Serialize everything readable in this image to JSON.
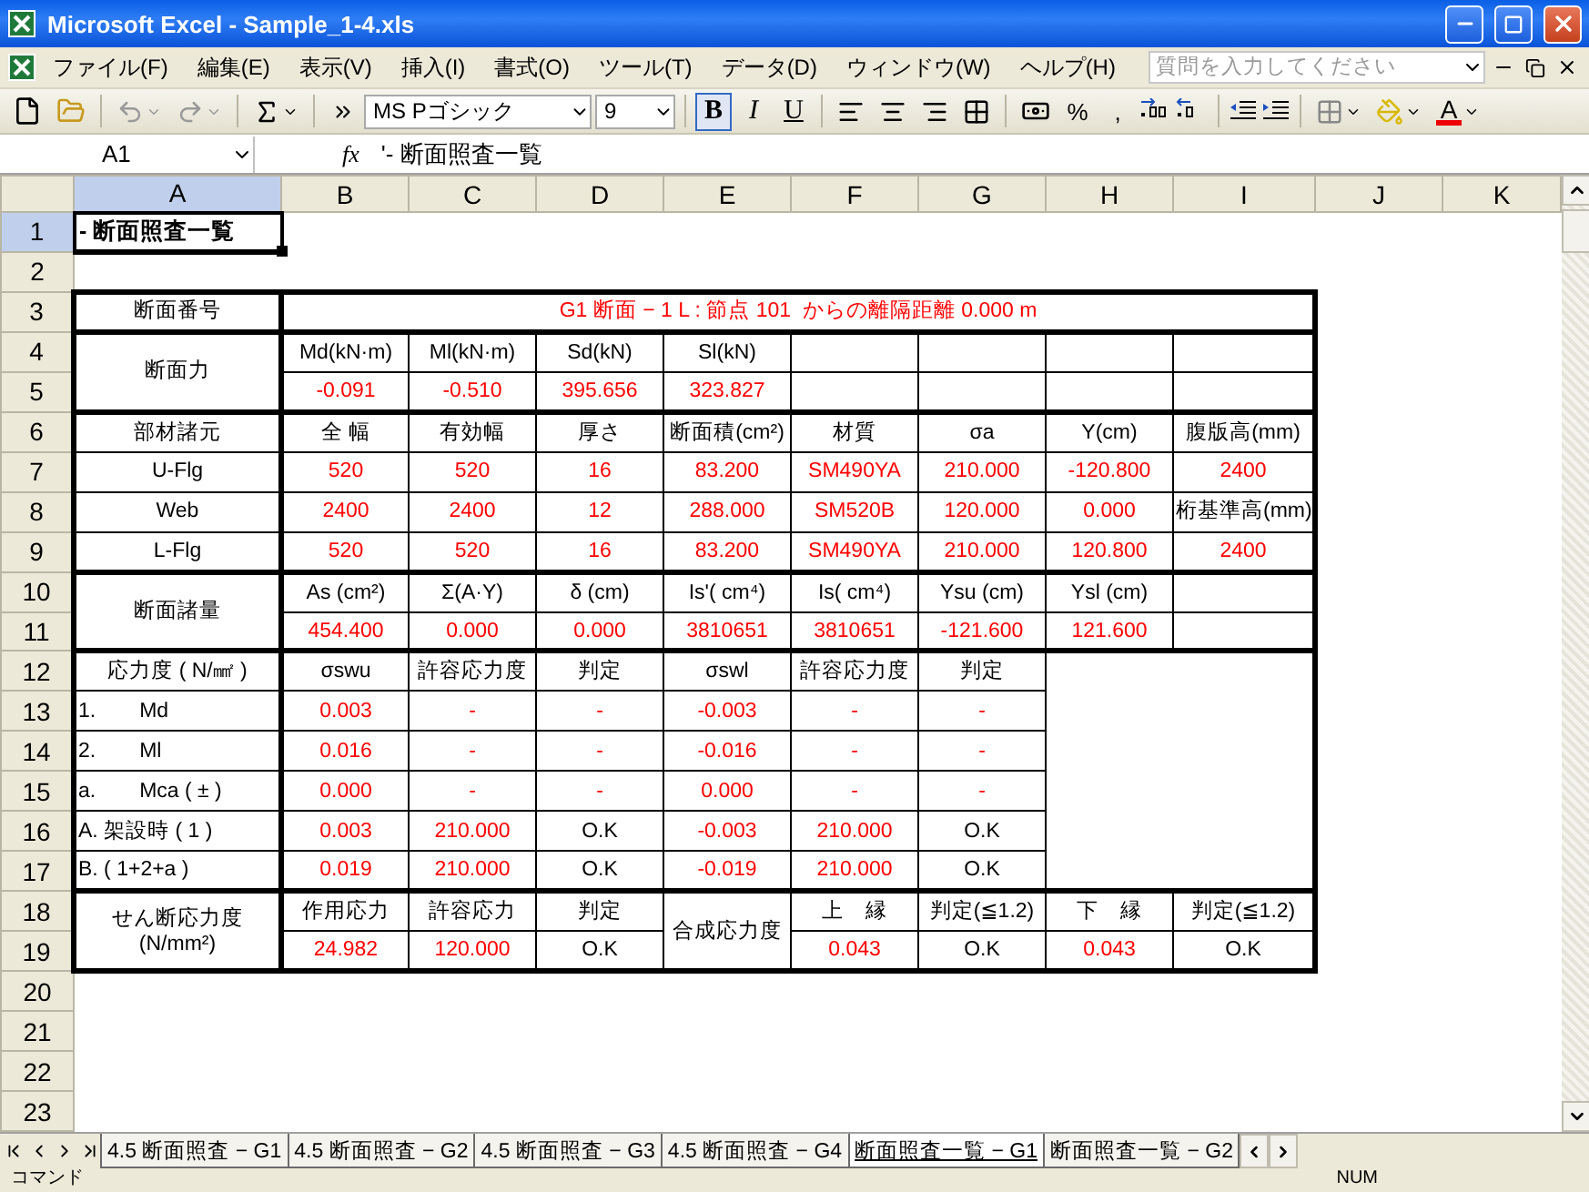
{
  "window": {
    "title": "Microsoft Excel - Sample_1-4.xls"
  },
  "menu": {
    "items": [
      "ファイル(F)",
      "編集(E)",
      "表示(V)",
      "挿入(I)",
      "書式(O)",
      "ツール(T)",
      "データ(D)",
      "ウィンドウ(W)",
      "ヘルプ(H)"
    ],
    "help_search": {
      "placeholder": "質問を入力してください"
    }
  },
  "toolbar": {
    "font": "MS Pゴシック",
    "size": "9",
    "styles": [
      {
        "label": "B",
        "selected": true
      },
      {
        "label": "I",
        "selected": false
      },
      {
        "label": "U",
        "selected": false
      }
    ],
    "number_formats": [
      "%",
      ","
    ],
    "font_color_label": "A"
  },
  "formula_bar": {
    "cell": "A1",
    "fx": "fx",
    "value": "'- 断面照査一覧"
  },
  "sheet": {
    "columns": [
      {
        "label": "A",
        "selected": true
      },
      {
        "label": "B",
        "selected": false
      },
      {
        "label": "C",
        "selected": false
      },
      {
        "label": "D",
        "selected": false
      },
      {
        "label": "E",
        "selected": false
      },
      {
        "label": "F",
        "selected": false
      },
      {
        "label": "G",
        "selected": false
      },
      {
        "label": "H",
        "selected": false
      },
      {
        "label": "I",
        "selected": false
      },
      {
        "label": "J",
        "selected": false
      },
      {
        "label": "K",
        "selected": false
      }
    ],
    "groups": [
      {
        "kind": "free",
        "rows": [
          {
            "number": "1",
            "selected": true,
            "cells": [
              {
                "kind": "title",
                "text": "- 断面照査一覧",
                "active": true
              }
            ]
          }
        ]
      },
      {
        "kind": "free",
        "rows": [
          {
            "number": "2",
            "selected": false
          }
        ]
      },
      {
        "kind": "table",
        "rows": [
          {
            "number": "3",
            "selected": false,
            "cells": [
              {
                "kind": "label",
                "text": "断面番号"
              },
              {
                "kind": "value",
                "text": "G1 断面 − 1 L : 節点 101  からの離隔距離 0.000 m",
                "colspan": 8
              }
            ]
          }
        ]
      },
      {
        "kind": "table",
        "rows": [
          {
            "number": "4",
            "selected": false,
            "cells": [
              {
                "kind": "label",
                "text": "断面力",
                "rowspan": 2
              },
              {
                "kind": "label",
                "text": "Md(kN·m)"
              },
              {
                "kind": "label",
                "text": "Ml(kN·m)"
              },
              {
                "kind": "label",
                "text": "Sd(kN)"
              },
              {
                "kind": "label",
                "text": "Sl(kN)"
              },
              {
                "kind": "blank"
              },
              {
                "kind": "blank"
              },
              {
                "kind": "blank"
              },
              {
                "kind": "blank"
              }
            ]
          },
          {
            "number": "5",
            "selected": false,
            "cells": [
              {
                "kind": "value",
                "text": "-0.091"
              },
              {
                "kind": "value",
                "text": "-0.510"
              },
              {
                "kind": "value",
                "text": "395.656"
              },
              {
                "kind": "value",
                "text": "323.827"
              },
              {
                "kind": "blank"
              },
              {
                "kind": "blank"
              },
              {
                "kind": "blank"
              },
              {
                "kind": "blank"
              }
            ]
          }
        ]
      },
      {
        "kind": "table",
        "rows": [
          {
            "number": "6",
            "selected": false,
            "cells": [
              {
                "kind": "label",
                "text": "部材諸元"
              },
              {
                "kind": "label",
                "text": "全 幅"
              },
              {
                "kind": "label",
                "text": "有効幅"
              },
              {
                "kind": "label",
                "text": "厚さ"
              },
              {
                "kind": "label",
                "text": "断面積(cm²)"
              },
              {
                "kind": "label",
                "text": "材質"
              },
              {
                "kind": "label",
                "text": "σa"
              },
              {
                "kind": "label",
                "text": "Y(cm)"
              },
              {
                "kind": "label",
                "text": "腹版高(mm)"
              }
            ]
          },
          {
            "number": "7",
            "selected": false,
            "cells": [
              {
                "kind": "label",
                "text": "U-Flg"
              },
              {
                "kind": "value",
                "text": "520"
              },
              {
                "kind": "value",
                "text": "520"
              },
              {
                "kind": "value",
                "text": "16"
              },
              {
                "kind": "value",
                "text": "83.200"
              },
              {
                "kind": "value",
                "text": "SM490YA"
              },
              {
                "kind": "value",
                "text": "210.000"
              },
              {
                "kind": "value",
                "text": "-120.800"
              },
              {
                "kind": "value",
                "text": "2400"
              }
            ]
          },
          {
            "number": "8",
            "selected": false,
            "cells": [
              {
                "kind": "label",
                "text": "Web"
              },
              {
                "kind": "value",
                "text": "2400"
              },
              {
                "kind": "value",
                "text": "2400"
              },
              {
                "kind": "value",
                "text": "12"
              },
              {
                "kind": "value",
                "text": "288.000"
              },
              {
                "kind": "value",
                "text": "SM520B"
              },
              {
                "kind": "value",
                "text": "120.000"
              },
              {
                "kind": "value",
                "text": "0.000"
              },
              {
                "kind": "label",
                "text": "桁基準高(mm)"
              }
            ]
          },
          {
            "number": "9",
            "selected": false,
            "cells": [
              {
                "kind": "label",
                "text": "L-Flg"
              },
              {
                "kind": "value",
                "text": "520"
              },
              {
                "kind": "value",
                "text": "520"
              },
              {
                "kind": "value",
                "text": "16"
              },
              {
                "kind": "value",
                "text": "83.200"
              },
              {
                "kind": "value",
                "text": "SM490YA"
              },
              {
                "kind": "value",
                "text": "210.000"
              },
              {
                "kind": "value",
                "text": "120.800"
              },
              {
                "kind": "value",
                "text": "2400"
              }
            ]
          }
        ]
      },
      {
        "kind": "table",
        "rows": [
          {
            "number": "10",
            "selected": false,
            "cells": [
              {
                "kind": "label",
                "text": "断面諸量",
                "rowspan": 2
              },
              {
                "kind": "label",
                "text": "As (cm²)"
              },
              {
                "kind": "label",
                "text": "Σ(A·Y)"
              },
              {
                "kind": "label",
                "text": "δ (cm)"
              },
              {
                "kind": "label",
                "text": "Is'( cm⁴)"
              },
              {
                "kind": "label",
                "text": "Is( cm⁴)"
              },
              {
                "kind": "label",
                "text": "Ysu (cm)"
              },
              {
                "kind": "label",
                "text": "Ysl (cm)"
              },
              {
                "kind": "blank"
              }
            ]
          },
          {
            "number": "11",
            "selected": false,
            "cells": [
              {
                "kind": "value",
                "text": "454.400"
              },
              {
                "kind": "value",
                "text": "0.000"
              },
              {
                "kind": "value",
                "text": "0.000"
              },
              {
                "kind": "value",
                "text": "3810651"
              },
              {
                "kind": "value",
                "text": "3810651"
              },
              {
                "kind": "value",
                "text": "-121.600"
              },
              {
                "kind": "value",
                "text": "121.600"
              },
              {
                "kind": "blank"
              }
            ]
          }
        ]
      },
      {
        "kind": "table",
        "rows": [
          {
            "number": "12",
            "selected": false,
            "cells": [
              {
                "kind": "label",
                "text": "応力度 ( N/㎟ )"
              },
              {
                "kind": "label",
                "text": "σswu"
              },
              {
                "kind": "label",
                "text": "許容応力度"
              },
              {
                "kind": "label",
                "text": "判定"
              },
              {
                "kind": "label",
                "text": "σswl"
              },
              {
                "kind": "label",
                "text": "許容応力度"
              },
              {
                "kind": "label",
                "text": "判定"
              },
              {
                "kind": "block",
                "rowspan": 6,
                "colspan": 2
              }
            ]
          },
          {
            "number": "13",
            "selected": false,
            "cells": [
              {
                "kind": "item",
                "text": "1.　　Md"
              },
              {
                "kind": "value",
                "text": "0.003"
              },
              {
                "kind": "value",
                "text": "-"
              },
              {
                "kind": "value",
                "text": "-"
              },
              {
                "kind": "value",
                "text": "-0.003"
              },
              {
                "kind": "value",
                "text": "-"
              },
              {
                "kind": "value",
                "text": "-"
              }
            ]
          },
          {
            "number": "14",
            "selected": false,
            "cells": [
              {
                "kind": "item",
                "text": "2.　　Ml"
              },
              {
                "kind": "value",
                "text": "0.016"
              },
              {
                "kind": "value",
                "text": "-"
              },
              {
                "kind": "value",
                "text": "-"
              },
              {
                "kind": "value",
                "text": "-0.016"
              },
              {
                "kind": "value",
                "text": "-"
              },
              {
                "kind": "value",
                "text": "-"
              }
            ]
          },
          {
            "number": "15",
            "selected": false,
            "cells": [
              {
                "kind": "item",
                "text": "a.　　Mca ( ± )"
              },
              {
                "kind": "value",
                "text": "0.000"
              },
              {
                "kind": "value",
                "text": "-"
              },
              {
                "kind": "value",
                "text": "-"
              },
              {
                "kind": "value",
                "text": "0.000"
              },
              {
                "kind": "value",
                "text": "-"
              },
              {
                "kind": "value",
                "text": "-"
              }
            ]
          },
          {
            "number": "16",
            "selected": false,
            "cells": [
              {
                "kind": "item",
                "text": "A. 架設時 ( 1 )"
              },
              {
                "kind": "value",
                "text": "0.003"
              },
              {
                "kind": "value",
                "text": "210.000"
              },
              {
                "kind": "label",
                "text": "O.K"
              },
              {
                "kind": "value",
                "text": "-0.003"
              },
              {
                "kind": "value",
                "text": "210.000"
              },
              {
                "kind": "label",
                "text": "O.K"
              }
            ]
          },
          {
            "number": "17",
            "selected": false,
            "cells": [
              {
                "kind": "item",
                "text": "B. ( 1+2+a )"
              },
              {
                "kind": "value",
                "text": "0.019"
              },
              {
                "kind": "value",
                "text": "210.000"
              },
              {
                "kind": "label",
                "text": "O.K"
              },
              {
                "kind": "value",
                "text": "-0.019"
              },
              {
                "kind": "value",
                "text": "210.000"
              },
              {
                "kind": "label",
                "text": "O.K"
              }
            ]
          }
        ]
      },
      {
        "kind": "table",
        "rows": [
          {
            "number": "18",
            "selected": false,
            "cells": [
              {
                "kind": "label",
                "text": "せん断応力度\n(N/mm²)",
                "rowspan": 2
              },
              {
                "kind": "label",
                "text": "作用応力"
              },
              {
                "kind": "label",
                "text": "許容応力"
              },
              {
                "kind": "label",
                "text": "判定"
              },
              {
                "kind": "label",
                "text": "合成応力度",
                "rowspan": 2
              },
              {
                "kind": "label",
                "text": "上　縁"
              },
              {
                "kind": "label",
                "text": "判定(≦1.2)"
              },
              {
                "kind": "label",
                "text": "下　縁"
              },
              {
                "kind": "label",
                "text": "判定(≦1.2)"
              }
            ]
          },
          {
            "number": "19",
            "selected": false,
            "cells": [
              {
                "kind": "value",
                "text": "24.982"
              },
              {
                "kind": "value",
                "text": "120.000"
              },
              {
                "kind": "label",
                "text": "O.K"
              },
              {
                "kind": "value",
                "text": "0.043"
              },
              {
                "kind": "label",
                "text": "O.K"
              },
              {
                "kind": "value",
                "text": "0.043"
              },
              {
                "kind": "label",
                "text": "O.K"
              }
            ]
          }
        ]
      },
      {
        "kind": "free",
        "rows": [
          {
            "number": "20",
            "selected": false
          },
          {
            "number": "21",
            "selected": false
          },
          {
            "number": "22",
            "selected": false
          },
          {
            "number": "23",
            "selected": false
          }
        ]
      }
    ]
  },
  "sheet_tabs": [
    {
      "label": "4.5 断面照査 − G1",
      "selected": false
    },
    {
      "label": "4.5 断面照査 − G2",
      "selected": false
    },
    {
      "label": "4.5 断面照査 − G3",
      "selected": false
    },
    {
      "label": "4.5 断面照査 − G4",
      "selected": false
    },
    {
      "label": "断面照査一覧 − G1",
      "selected": true
    },
    {
      "label": "断面照査一覧 − G2",
      "selected": false
    }
  ],
  "status_bar": {
    "mode": "コマンド",
    "num": "NUM"
  }
}
